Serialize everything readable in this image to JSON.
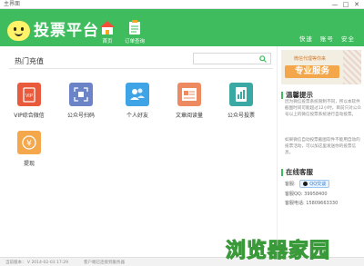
{
  "window": {
    "title": "主界面",
    "controls": [
      "—",
      "□",
      "✕"
    ]
  },
  "header": {
    "brand": "投票平台",
    "nav": [
      {
        "label": "首页",
        "icon": "home-icon"
      },
      {
        "label": "订单查询",
        "icon": "clipboard-icon"
      }
    ],
    "links": [
      "快速",
      "账号",
      "安全"
    ],
    "background": "#3fbd5e"
  },
  "main": {
    "section_title": "热门充值",
    "search": {
      "placeholder": "",
      "value": ""
    },
    "tiles": [
      {
        "label": "VIP综合微信",
        "icon": "vip-card-icon",
        "color": "#e9593b"
      },
      {
        "label": "公众号扫码",
        "icon": "scan-icon",
        "color": "#6b84c8"
      },
      {
        "label": "个人好友",
        "icon": "people-icon",
        "color": "#3fa4e6"
      },
      {
        "label": "文章阅读量",
        "icon": "article-icon",
        "color": "#ee8a62"
      },
      {
        "label": "公众号投票",
        "icon": "vote-chart-icon",
        "color": "#3aa9a3"
      },
      {
        "label": "提现",
        "icon": "yuan-icon",
        "color": "#f5a74b"
      }
    ]
  },
  "sidebar": {
    "banner": {
      "small_text": "微信代理等你来",
      "big_text": "专业服务"
    },
    "notice": {
      "title": "温馨提示",
      "para1": "因为微信投票系统限制不同，所以本软件截图时间可能超过12小时，目前只对公众号以上的微信投票系统进行自动投票。",
      "para2": "如果微信自动投票截图软件不能用自动的投票活动，可以加这里发送你的投票信息。"
    },
    "service": {
      "title": "在线客服",
      "rows": [
        {
          "label": "客服:",
          "button": "QQ交谈"
        },
        {
          "label": "客服QQ:",
          "value": "39958400"
        },
        {
          "label": "客服电话:",
          "value": "15809663330"
        }
      ]
    }
  },
  "status_bar": {
    "left": "当前版本： V 2014-02-03 17:29",
    "middle": "客户端已连接到服务器"
  },
  "watermark": "浏览器家园"
}
